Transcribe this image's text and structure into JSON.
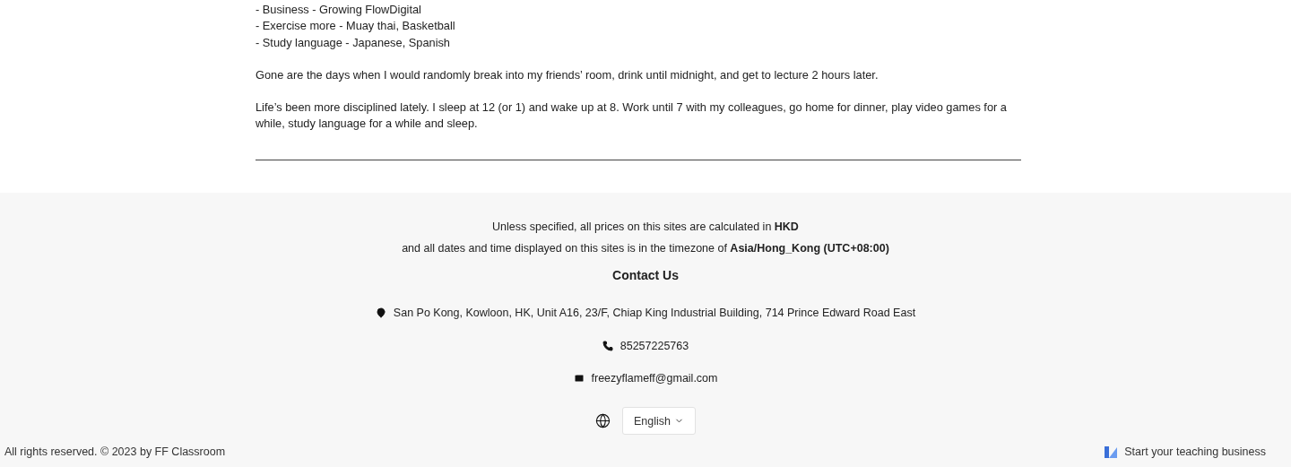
{
  "article": {
    "list": [
      "- Business - Growing FlowDigital",
      "- Exercise more - Muay thai, Basketball",
      "- Study language - Japanese, Spanish"
    ],
    "paragraphs": [
      "Gone are the days when I would randomly break into my friends’ room, drink until midnight, and get to lecture 2 hours later.",
      "Life’s been more disciplined lately. I sleep at 12 (or 1) and wake up at 8. Work until 7 with my colleagues, go home for dinner, play video games for a while, study language for a while and sleep."
    ]
  },
  "footer": {
    "notices": [
      "Unless specified, all prices on this sites are calculated in **HKD**",
      "and all dates and time displayed on this sites is in the timezone of **Asia/Hong_Kong (UTC+08:00)**"
    ],
    "contact_title": "Contact Us",
    "contacts": [
      {
        "kind": "address",
        "text": "San Po Kong, Kowloon, HK, Unit A16, 23/F, Chiap King Industrial Building, 714 Prince Edward Road East"
      },
      {
        "kind": "phone",
        "text": "85257225763"
      },
      {
        "kind": "email",
        "text": "freezyflameff@gmail.com"
      }
    ],
    "language": "English",
    "copyright": "All rights reserved. © 2023 by FF Classroom",
    "promo_link": "Start your teaching business"
  }
}
